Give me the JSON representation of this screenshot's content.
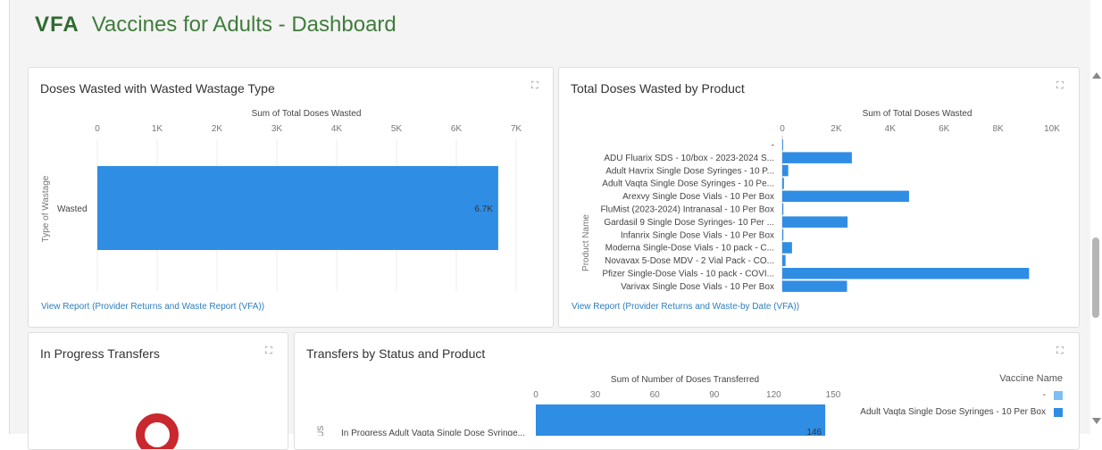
{
  "header": {
    "logo": "VFA",
    "title": "Vaccines for Adults - Dashboard"
  },
  "colors": {
    "bar": "#2f8de4",
    "bar_light": "#7fbdf0",
    "accent_green": "#3f7d3a",
    "link": "#2b7fc1",
    "donut": "#c8282e"
  },
  "cards": {
    "doses_wasted": {
      "title": "Doses Wasted with Wasted Wastage Type",
      "link": "View Report (Provider Returns and Waste Report (VFA))",
      "expand_icon": "expand-icon"
    },
    "total_wasted_by_product": {
      "title": "Total Doses Wasted by Product",
      "link": "View Report (Provider Returns and Waste-by Date (VFA))",
      "expand_icon": "expand-icon"
    },
    "in_progress_transfers": {
      "title": "In Progress Transfers",
      "expand_icon": "expand-icon"
    },
    "transfers_by_status": {
      "title": "Transfers by Status and Product",
      "expand_icon": "expand-icon",
      "legend_title": "Vaccine Name",
      "legend": [
        {
          "label": "-",
          "color": "#7fbdf0"
        },
        {
          "label": "Adult Vaqta Single Dose Syringes - 10 Per Box",
          "color": "#2f8de4"
        }
      ]
    }
  },
  "chart_data": [
    {
      "type": "bar",
      "orientation": "horizontal",
      "title": "Sum of Total Doses Wasted",
      "xlabel": "Sum of Total Doses Wasted",
      "ylabel": "Type of Wastage",
      "categories": [
        "Wasted"
      ],
      "values": [
        6700
      ],
      "data_labels": [
        "6.7K"
      ],
      "xlim": [
        0,
        7000
      ],
      "tick_values": [
        0,
        1000,
        2000,
        3000,
        4000,
        5000,
        6000,
        7000
      ],
      "tick_labels": [
        "0",
        "1K",
        "2K",
        "3K",
        "4K",
        "5K",
        "6K",
        "7K"
      ],
      "grid": true
    },
    {
      "type": "bar",
      "orientation": "horizontal",
      "title": "Sum of Total Doses Wasted",
      "xlabel": "Sum of Total Doses Wasted",
      "ylabel": "Product Name",
      "categories": [
        "-",
        "ADU Fluarix SDS - 10/box - 2023-2024 S...",
        "Adult Havrix Single Dose Syringes - 10 P...",
        "Adult Vaqta Single Dose Syringes - 10 Pe...",
        "Arexvy Single Dose Vials - 10 Per Box",
        "FluMist (2023-2024) Intranasal - 10 Per Box",
        "Gardasil 9 Single Dose Syringes- 10 Per ...",
        "Infanrix Single Dose Vials - 10 Per Box",
        "Moderna Single-Dose Vials - 10 pack - C...",
        "Novavax 5-Dose MDV - 2 Vial Pack - CO...",
        "Pfizer Single-Dose Vials - 10 pack - COVI...",
        "Varivax Single Dose Vials - 10 Per Box"
      ],
      "values": [
        30,
        2580,
        220,
        60,
        4700,
        40,
        2420,
        40,
        360,
        120,
        9150,
        2400
      ],
      "xlim": [
        0,
        10000
      ],
      "tick_values": [
        0,
        2000,
        4000,
        6000,
        8000,
        10000
      ],
      "tick_labels": [
        "0",
        "2K",
        "4K",
        "6K",
        "8K",
        "10K"
      ],
      "grid": false
    },
    {
      "type": "bar",
      "orientation": "horizontal",
      "stacked": true,
      "title": "Sum of Number of Doses Transferred",
      "xlabel": "Sum of Number of Doses Transferred",
      "ylabel": "US",
      "categories": [
        "In Progress"
      ],
      "category_label": "In Progress Adult Vaqta Single Dose Syringe...",
      "series": [
        {
          "name": "-",
          "values": [
            0
          ]
        },
        {
          "name": "Adult Vaqta Single Dose Syringes - 10 Per Box",
          "values": [
            146
          ]
        }
      ],
      "data_labels": [
        "146"
      ],
      "xlim": [
        0,
        150
      ],
      "tick_values": [
        0,
        30,
        60,
        90,
        120,
        150
      ],
      "tick_labels": [
        "0",
        "30",
        "60",
        "90",
        "120",
        "150"
      ],
      "grid": false
    }
  ]
}
